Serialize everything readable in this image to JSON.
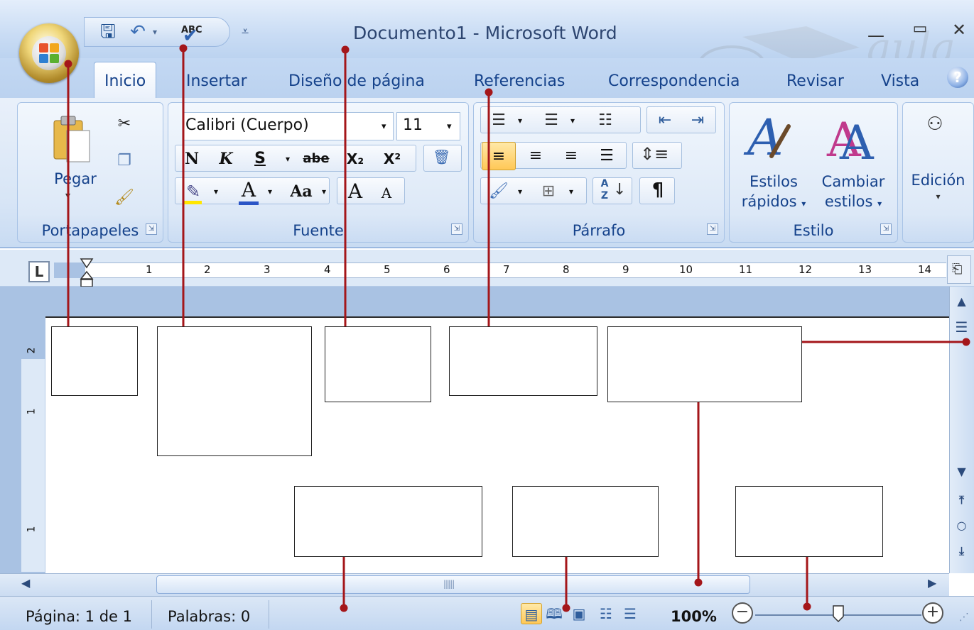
{
  "window": {
    "title": "Documento1 - Microsoft Word"
  },
  "quick_access": {
    "items": [
      {
        "name": "save-icon",
        "glyph": "🖫"
      },
      {
        "name": "undo-icon",
        "glyph": "↶"
      },
      {
        "name": "undo-dropdown-icon",
        "glyph": "▾"
      },
      {
        "name": "spelling-icon",
        "label": "ABC"
      },
      {
        "name": "customize-icon",
        "glyph": "⩡"
      }
    ]
  },
  "tabs": [
    {
      "label": "Inicio",
      "active": true
    },
    {
      "label": "Insertar"
    },
    {
      "label": "Diseño de página"
    },
    {
      "label": "Referencias"
    },
    {
      "label": "Correspondencia"
    },
    {
      "label": "Revisar"
    },
    {
      "label": "Vista"
    }
  ],
  "ribbon": {
    "clipboard": {
      "label": "Portapapeles",
      "paste_label": "Pegar"
    },
    "font": {
      "label": "Fuente",
      "font_name": "Calibri (Cuerpo)",
      "font_size": "11",
      "bold": "N",
      "italic": "K",
      "underline": "S",
      "strikethrough": "abe",
      "subscript": "X₂",
      "superscript": "X²",
      "change_case": "Aa",
      "grow": "A",
      "shrink": "A",
      "font_color": "A"
    },
    "paragraph": {
      "label": "Párrafo",
      "pilcrow": "¶",
      "sort": "A Z"
    },
    "styles": {
      "label": "Estilo",
      "quick_styles": [
        "Estilos",
        "rápidos"
      ],
      "change_styles": [
        "Cambiar",
        "estilos"
      ]
    },
    "editing": {
      "label": "Edición"
    }
  },
  "ruler": {
    "h_numbers": [
      "1",
      "2",
      "3",
      "4",
      "5",
      "6",
      "7",
      "8",
      "9",
      "10",
      "11",
      "12",
      "13",
      "14"
    ],
    "v_numbers": [
      "2",
      "1",
      "1"
    ],
    "tab_selector": "L"
  },
  "status": {
    "page": "Página: 1 de 1",
    "words": "Palabras: 0",
    "zoom": "100%"
  },
  "colors": {
    "accent": "#15428b",
    "leader": "#a4161a",
    "ribbon_bg": "#dce8f7"
  }
}
